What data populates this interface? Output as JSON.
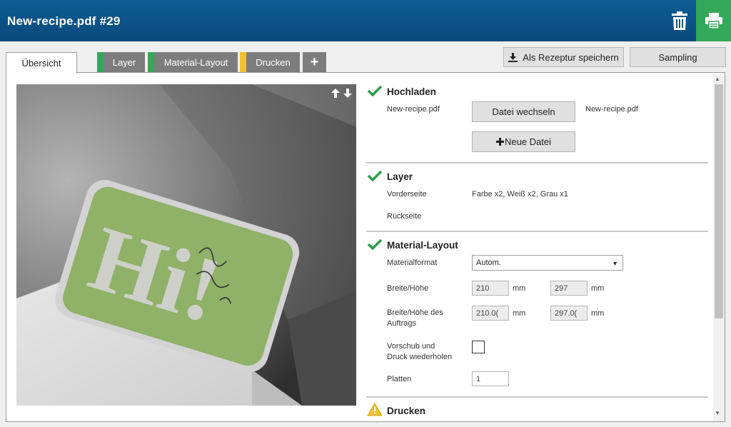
{
  "header": {
    "title": "New-recipe.pdf #29",
    "trash_icon": "trash-icon",
    "print_icon": "printer-icon",
    "print_color": "#34a85a",
    "bar_color": "#0a5488"
  },
  "tabs": [
    {
      "label": "Übersicht",
      "active": true
    },
    {
      "label": "Layer",
      "stripe": "#34a85a"
    },
    {
      "label": "Material-Layout",
      "stripe": "#34a85a"
    },
    {
      "label": "Drucken",
      "stripe": "#f2c12e"
    },
    {
      "label": "+"
    }
  ],
  "actions": {
    "save_recipe": "Als Rezeptur speichern",
    "save_icon": "download-icon",
    "sampling": "Sampling"
  },
  "preview": {
    "card_text": "Hi!",
    "arrows_icon": "up-down-arrows-icon"
  },
  "upload": {
    "title": "Hochladen",
    "status_icon": "check-icon",
    "file_name": "New-recipe.pdf",
    "change_file": "Datei wechseln",
    "current_file": "New-recipe.pdf",
    "new_file": "Neue Datei"
  },
  "layer": {
    "title": "Layer",
    "status_icon": "check-icon",
    "front_label": "Vorderseite",
    "front_value": "Farbe x2, Weiß x2, Grau x1",
    "back_label": "Rückseite"
  },
  "material_layout": {
    "title": "Material-Layout",
    "status_icon": "check-icon",
    "format_label": "Materialformat",
    "format_value": "Autom.",
    "size_label": "Breite/Höhe",
    "width": "210",
    "height": "297",
    "unit": "mm",
    "job_size_label_1": "Breite/Höhe des",
    "job_size_label_2": "Auftrags",
    "job_width": "210.0(",
    "job_height": "297.0(",
    "repeat_label_1": "Vorschub und",
    "repeat_label_2": "Druck wiederholen",
    "repeat_checked": false,
    "plates_label": "Platten",
    "plates_value": "1"
  },
  "print": {
    "title": "Drucken",
    "status_icon": "warning-icon"
  }
}
